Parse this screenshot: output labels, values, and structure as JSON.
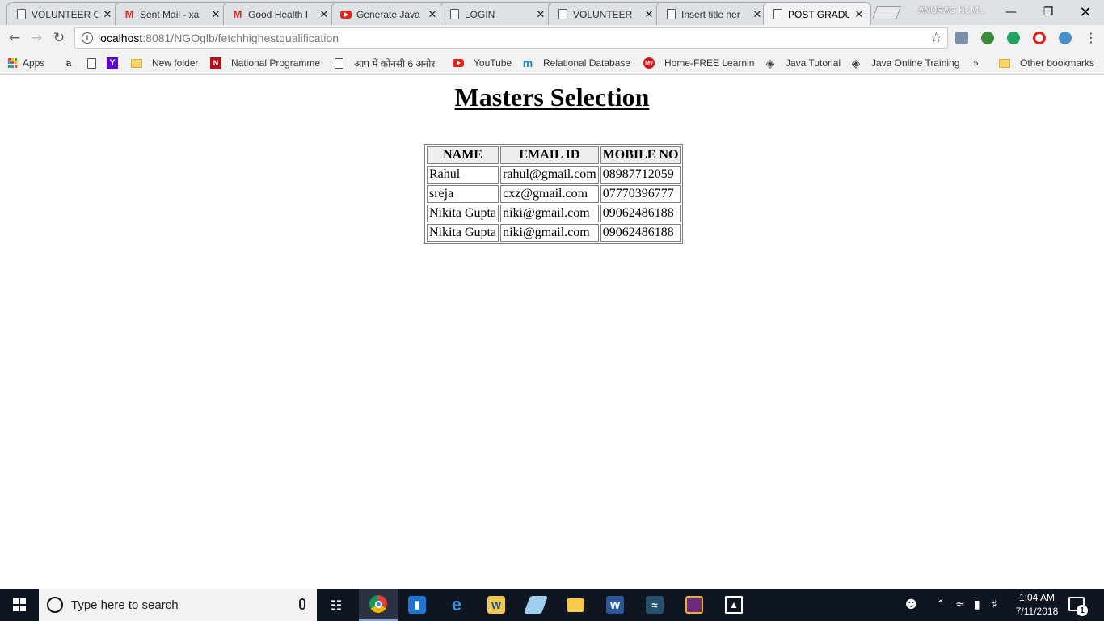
{
  "browser": {
    "tabs": [
      {
        "title": "VOLUNTEER C",
        "favicon": "page-icon",
        "active": false
      },
      {
        "title": "Sent Mail - xa",
        "favicon": "gmail-icon",
        "active": false
      },
      {
        "title": "Good Health I",
        "favicon": "gmail-icon",
        "active": false
      },
      {
        "title": "Generate Java",
        "favicon": "youtube-icon",
        "active": false
      },
      {
        "title": "LOGIN",
        "favicon": "page-icon",
        "active": false
      },
      {
        "title": "VOLUNTEER",
        "favicon": "page-icon",
        "active": false
      },
      {
        "title": "Insert title her",
        "favicon": "page-icon",
        "active": false
      },
      {
        "title": "POST GRADU",
        "favicon": "page-icon",
        "active": true
      }
    ],
    "tab_close_glyph": "✕",
    "profile_name": "ANURAG KUM...",
    "address": {
      "host": "localhost",
      "path": ":8081/NGOglb/fetchhighestqualification"
    },
    "bookmarks": [
      {
        "label": "Apps",
        "icon": "apps-grid-icon"
      },
      {
        "label": "",
        "icon": "amazon-icon"
      },
      {
        "label": "",
        "icon": "page-icon"
      },
      {
        "label": "",
        "icon": "yahoo-icon"
      },
      {
        "label": "New folder",
        "icon": "folder-icon"
      },
      {
        "label": "National Programme",
        "icon": "nptel-icon"
      },
      {
        "label": "आप में कोनसी 6 अनोर",
        "icon": "page-icon"
      },
      {
        "label": "YouTube",
        "icon": "youtube-icon"
      },
      {
        "label": "Relational Database",
        "icon": "m-icon"
      },
      {
        "label": "Home-FREE Learning",
        "icon": "my-icon"
      },
      {
        "label": "Java Tutorial",
        "icon": "diamond-icon"
      },
      {
        "label": "Java Online Training",
        "icon": "diamond-icon"
      },
      {
        "label": "»",
        "icon": ""
      },
      {
        "label": "Other bookmarks",
        "icon": "folder-icon"
      }
    ]
  },
  "page": {
    "title": "Masters Selection",
    "table": {
      "headers": [
        "NAME",
        "EMAIL ID",
        "MOBILE NO"
      ],
      "rows": [
        [
          "Rahul",
          "rahul@gmail.com",
          "08987712059"
        ],
        [
          "sreja",
          "cxz@gmail.com",
          "07770396777"
        ],
        [
          "Nikita Gupta",
          "niki@gmail.com",
          "09062486188"
        ],
        [
          "Nikita Gupta",
          "niki@gmail.com",
          "09062486188"
        ]
      ]
    }
  },
  "taskbar": {
    "search_placeholder": "Type here to search",
    "time": "1:04 AM",
    "date": "7/11/2018",
    "notification_count": "1"
  },
  "colors": {
    "tab_strip": "#dee1e6",
    "toolbar": "#f2f2f2",
    "taskbar": "#101522"
  }
}
